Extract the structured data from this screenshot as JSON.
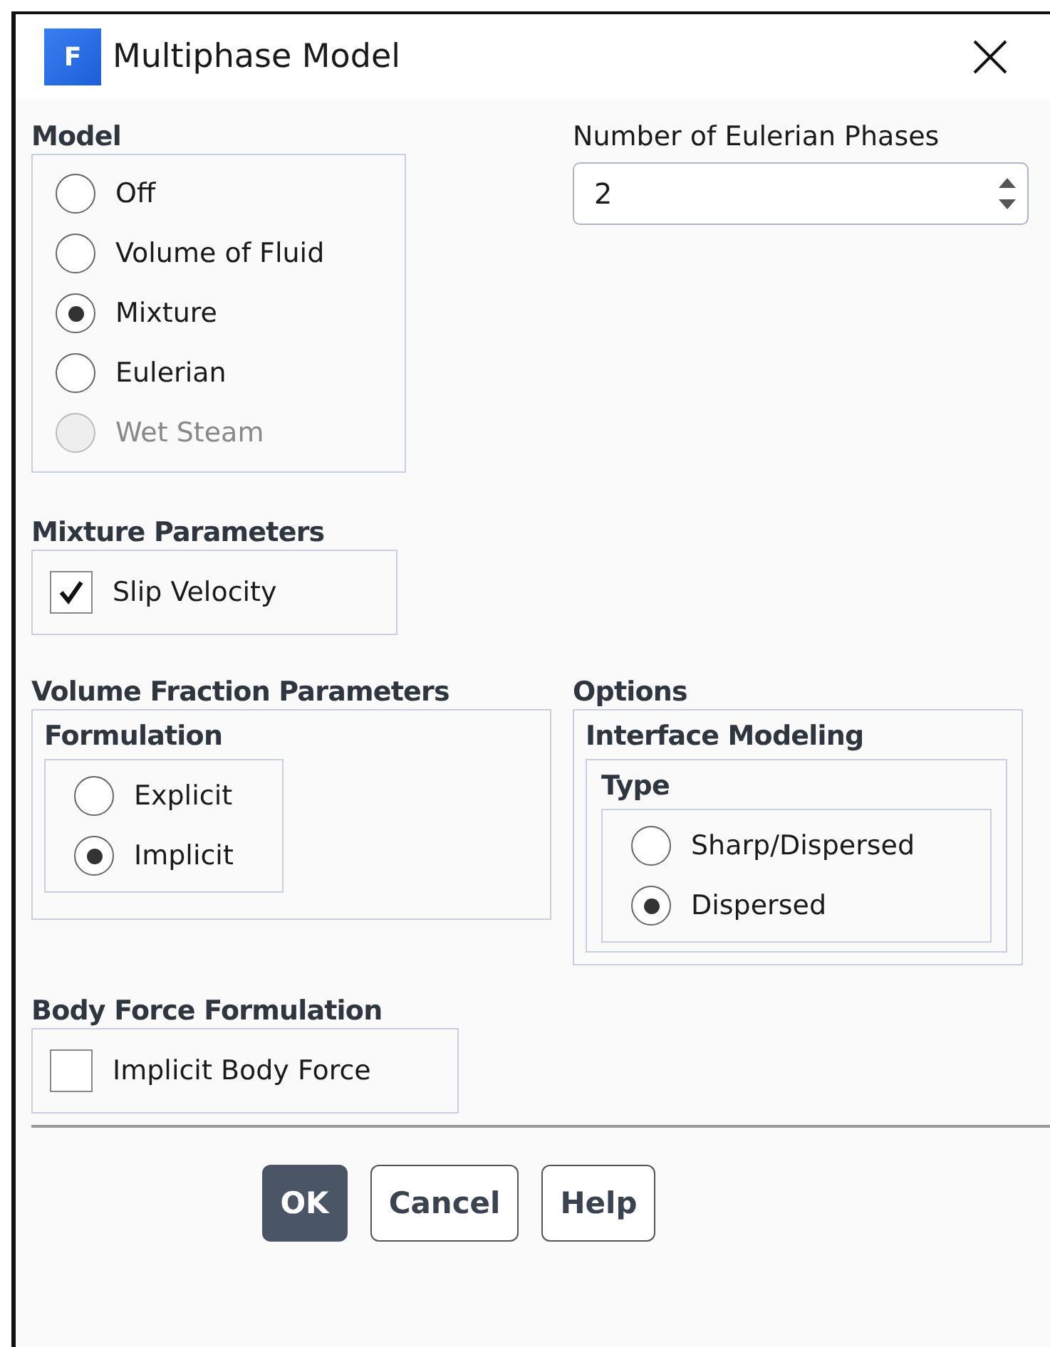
{
  "window": {
    "title": "Multiphase Model",
    "logo": "F"
  },
  "model": {
    "label": "Model",
    "options": [
      {
        "label": "Off",
        "selected": false,
        "disabled": false
      },
      {
        "label": "Volume of Fluid",
        "selected": false,
        "disabled": false
      },
      {
        "label": "Mixture",
        "selected": true,
        "disabled": false
      },
      {
        "label": "Eulerian",
        "selected": false,
        "disabled": false
      },
      {
        "label": "Wet Steam",
        "selected": false,
        "disabled": true
      }
    ]
  },
  "phases": {
    "label": "Number of Eulerian Phases",
    "value": "2"
  },
  "mixture_parameters": {
    "label": "Mixture Parameters",
    "options": [
      {
        "label": "Slip Velocity",
        "checked": true
      }
    ]
  },
  "volume_fraction": {
    "label": "Volume Fraction Parameters",
    "formulation": {
      "label": "Formulation",
      "options": [
        {
          "label": "Explicit",
          "selected": false,
          "disabled": false
        },
        {
          "label": "Implicit",
          "selected": true,
          "disabled": false
        }
      ]
    }
  },
  "options": {
    "label": "Options",
    "interface_modeling": {
      "label": "Interface Modeling",
      "type": {
        "label": "Type",
        "options": [
          {
            "label": "Sharp/Dispersed",
            "selected": false,
            "disabled": false
          },
          {
            "label": "Dispersed",
            "selected": true,
            "disabled": false
          }
        ]
      }
    }
  },
  "body_force": {
    "label": "Body Force Formulation",
    "options": [
      {
        "label": "Implicit Body Force",
        "checked": false
      }
    ]
  },
  "buttons": [
    {
      "label": "OK",
      "kind": "primary"
    },
    {
      "label": "Cancel",
      "kind": "secondary"
    },
    {
      "label": "Help",
      "kind": "secondary"
    }
  ]
}
